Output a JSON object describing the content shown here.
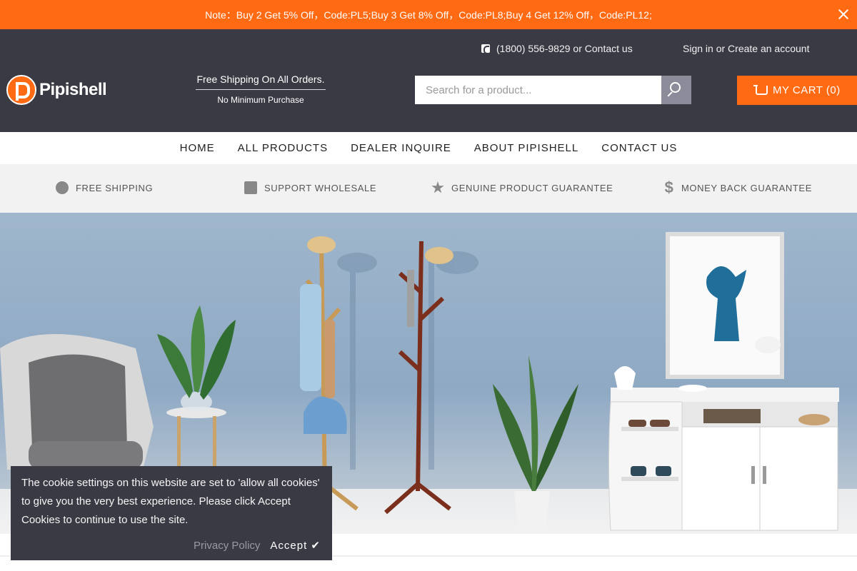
{
  "announcement": {
    "text": "Note：Buy 2 Get 5% Off，Code:PL5;Buy 3 Get 8% Off，Code:PL8;Buy 4 Get 12% Off，Code:PL12;",
    "close_icon": "close-icon"
  },
  "header": {
    "phone": "(1800) 556-9829",
    "or1": " or ",
    "contact": "Contact us",
    "signin": "Sign in",
    "or2": " or ",
    "create": "Create an account",
    "logo_text": "Pipishell",
    "shipping_title": "Free Shipping On All Orders.",
    "shipping_sub": "No Minimum Purchase",
    "search_placeholder": "Search for a product...",
    "cart_label": "MY CART (0)"
  },
  "nav": [
    "HOME",
    "ALL PRODUCTS",
    "DEALER INQUIRE",
    "ABOUT PIPISHELL",
    "CONTACT US"
  ],
  "features": [
    {
      "label": "FREE SHIPPING",
      "icon": "globe-icon"
    },
    {
      "label": "SUPPORT WHOLESALE",
      "icon": "gift-icon"
    },
    {
      "label": "GENUINE PRODUCT GUARANTEE",
      "icon": "star-icon"
    },
    {
      "label": "MONEY BACK GUARANTEE",
      "icon": "dollar-icon"
    }
  ],
  "cookie": {
    "text": "The cookie settings on this website are set to 'allow all cookies' to give you the very best experience. Please click Accept Cookies to continue to use the site.",
    "privacy": "Privacy Policy",
    "accept": "Accept ✔"
  },
  "colors": {
    "accent": "#ff6a13",
    "header_bg": "#3a3a44"
  }
}
